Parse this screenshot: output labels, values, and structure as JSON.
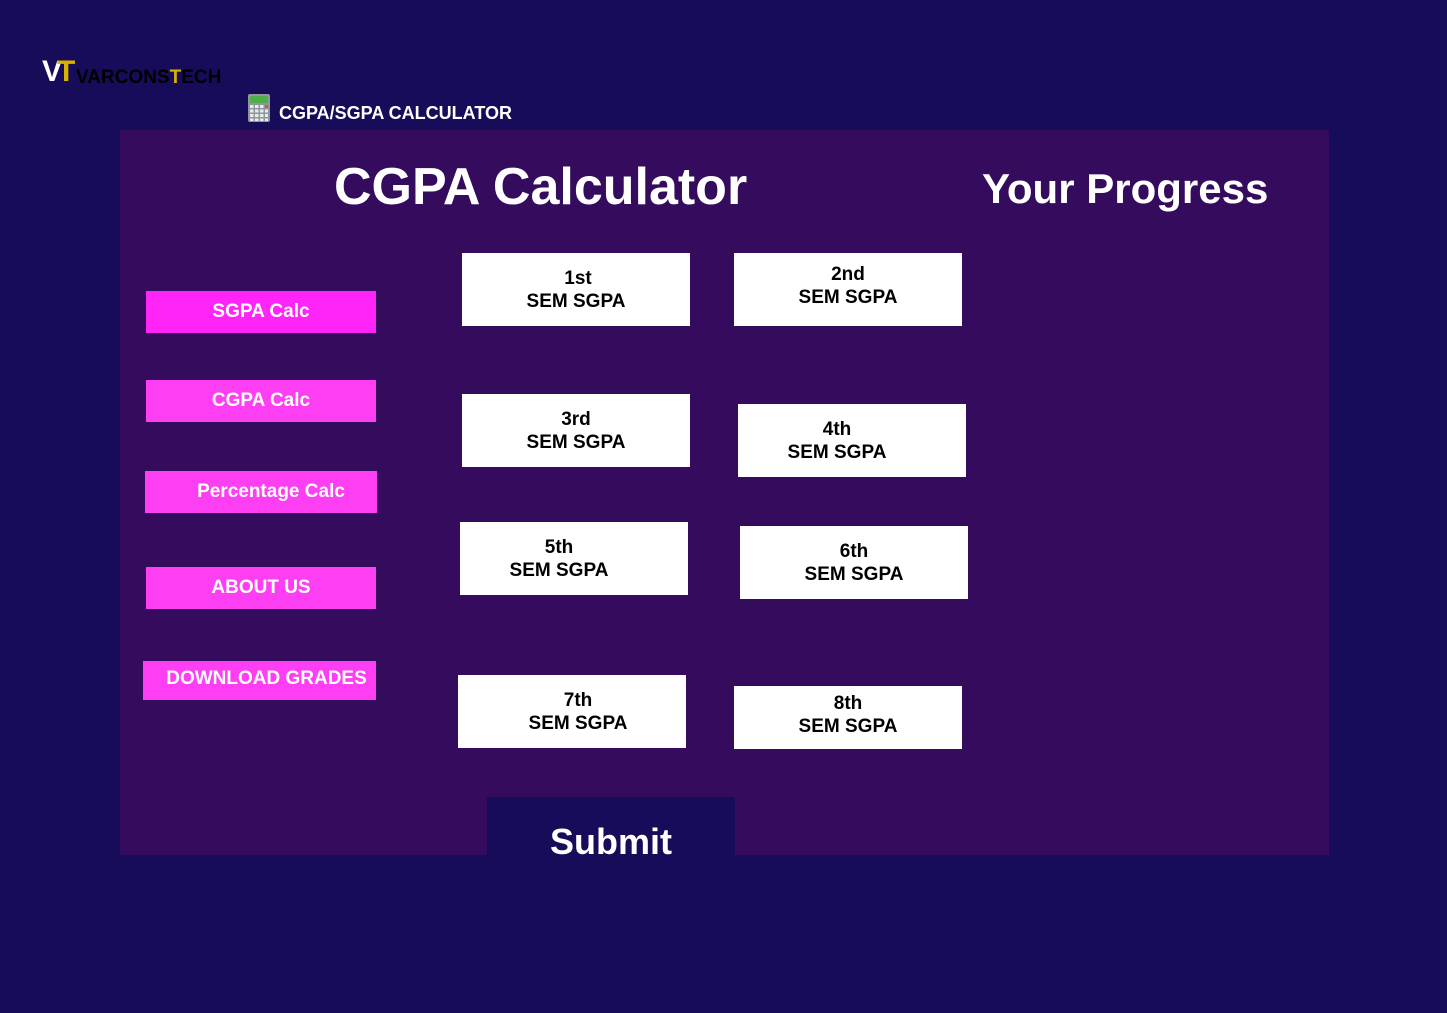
{
  "brand": {
    "mark_v": "V",
    "mark_t": "T",
    "name_a": "VARCONS",
    "name_t": "T",
    "name_b": "ECH"
  },
  "header": {
    "icon": "calculator-icon",
    "title": "CGPA/SGPA CALCULATOR"
  },
  "main": {
    "title": "CGPA Calculator",
    "progress_title": "Your Progress"
  },
  "sidebar": {
    "items": [
      {
        "label": "SGPA Calc",
        "color": "#ff24f7"
      },
      {
        "label": "CGPA Calc",
        "color": "#fd3ef3"
      },
      {
        "label": "Percentage Calc",
        "color": "#fd3ef3"
      },
      {
        "label": "ABOUT US",
        "color": "#fd3ef3"
      },
      {
        "label": "DOWNLOAD GRADES",
        "color": "#fd3ef3"
      }
    ]
  },
  "semesters": [
    {
      "ordinal": "1st",
      "label": "SEM SGPA"
    },
    {
      "ordinal": "2nd",
      "label": "SEM SGPA"
    },
    {
      "ordinal": "3rd",
      "label": "SEM SGPA"
    },
    {
      "ordinal": "4th",
      "label": "SEM SGPA"
    },
    {
      "ordinal": "5th",
      "label": "SEM SGPA"
    },
    {
      "ordinal": "6th",
      "label": "SEM SGPA"
    },
    {
      "ordinal": "7th",
      "label": "SEM SGPA"
    },
    {
      "ordinal": "8th",
      "label": "SEM SGPA"
    }
  ],
  "submit": {
    "label": "Submit"
  },
  "colors": {
    "background": "#170c59",
    "panel": "#340b5d",
    "accent": "#fd3ef3",
    "brand_gold": "#d9b200"
  }
}
